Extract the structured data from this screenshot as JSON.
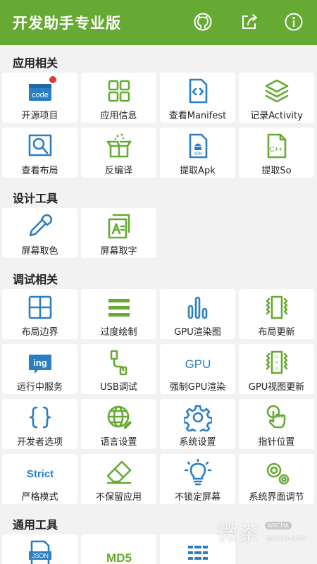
{
  "app": {
    "title": "开发助手专业版"
  },
  "toolbar": {
    "github_icon": "github-icon",
    "share_icon": "share-icon",
    "info_icon": "info-icon"
  },
  "sections": {
    "app": "应用相关",
    "design": "设计工具",
    "debug": "调试相关",
    "general": "通用工具"
  },
  "tiles": {
    "open_source": "开源项目",
    "app_info": "应用信息",
    "view_manifest": "查看Manifest",
    "record_activity": "记录Activity",
    "view_layout": "查看布局",
    "decompile": "反编译",
    "extract_apk": "提取Apk",
    "extract_so": "提取So",
    "screen_color": "屏幕取色",
    "screen_text": "屏幕取字",
    "layout_bounds": "布局边界",
    "overdraw": "过度绘制",
    "gpu_render": "GPU渲染图",
    "layout_update": "布局更新",
    "running_services": "运行中服务",
    "usb_debug": "USB调试",
    "force_gpu": "强制GPU渲染",
    "gpu_view_update": "GPU视图更新",
    "developer_options": "开发者选项",
    "language_settings": "语言设置",
    "system_settings": "系统设置",
    "pointer_location": "指针位置",
    "strict_mode": "严格模式",
    "dont_keep_activities": "不保留应用",
    "no_lock_screen": "不锁定屏幕",
    "system_ui_tuner": "系统界面调节"
  },
  "icon_text": {
    "code": "code",
    "apk": "APK",
    "cpp": "C++",
    "gpu": "GPU",
    "ing": "ing",
    "strict": "Strict",
    "json": "JSON",
    "md5": "MD5"
  },
  "watermark": {
    "brand": "微茶",
    "badge": "WXCHA",
    "url": "wxcha.com"
  },
  "colors": {
    "primary": "#66aa33",
    "accent_blue": "#2a7fc4",
    "badge_red": "#e53935"
  }
}
